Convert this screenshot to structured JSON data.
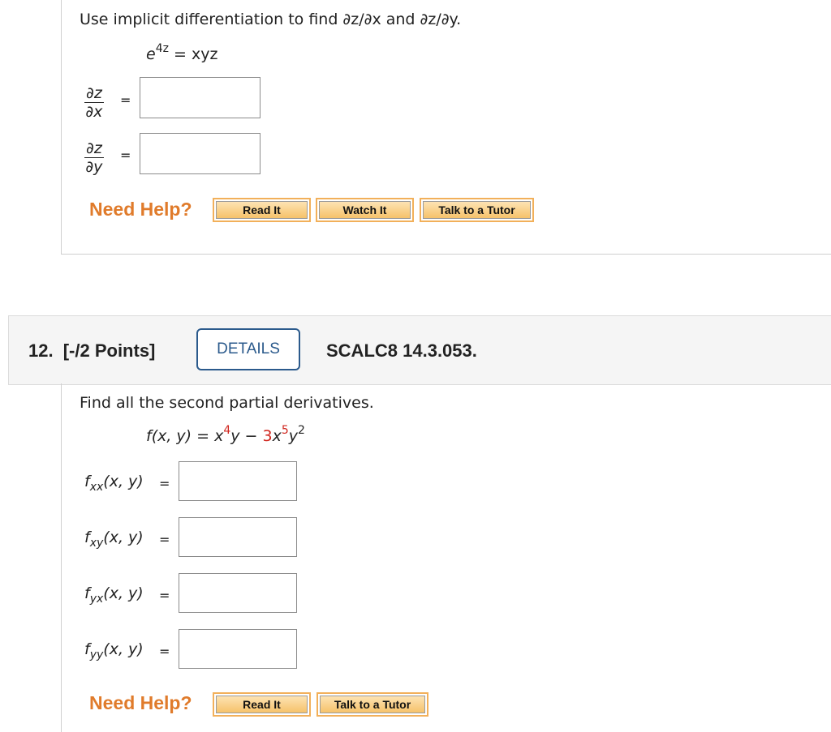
{
  "q11": {
    "instruction": "Use implicit differentiation to find ∂z/∂x and ∂z/∂y.",
    "equation": {
      "base": "e",
      "exp": "4z",
      "rhs": "= xyz"
    },
    "fractions": [
      {
        "num": "∂z",
        "den": "∂x",
        "eq": "="
      },
      {
        "num": "∂z",
        "den": "∂y",
        "eq": "="
      }
    ],
    "need_help": "Need Help?",
    "buttons": {
      "read": "Read It",
      "watch": "Watch It",
      "tutor": "Talk to a Tutor"
    }
  },
  "q12": {
    "number": "12.",
    "points": "[-/2 Points]",
    "details": "DETAILS",
    "code": "SCALC8 14.3.053.",
    "instruction": "Find all the second partial derivatives.",
    "function": {
      "lhs": "f(x, y) = x",
      "exp1": "4",
      "mid": "y − ",
      "coef": "3",
      "x": "x",
      "exp2": "5",
      "y": "y",
      "exp3": "2"
    },
    "partials": [
      {
        "f": "f",
        "sub": "xx",
        "args": "(x, y)",
        "eq": "="
      },
      {
        "f": "f",
        "sub": "xy",
        "args": "(x, y)",
        "eq": "="
      },
      {
        "f": "f",
        "sub": "yx",
        "args": "(x, y)",
        "eq": "="
      },
      {
        "f": "f",
        "sub": "yy",
        "args": "(x, y)",
        "eq": "="
      }
    ],
    "need_help": "Need Help?",
    "buttons": {
      "read": "Read It",
      "tutor": "Talk to a Tutor"
    }
  }
}
